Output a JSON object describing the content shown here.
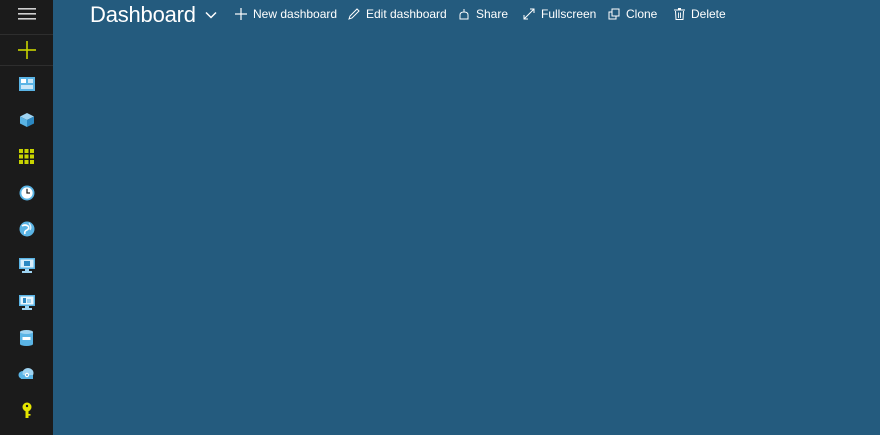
{
  "header": {
    "title": "Dashboard"
  },
  "toolbar": {
    "buttons": [
      {
        "id": "new",
        "label": "New dashboard",
        "icon": "plus-icon"
      },
      {
        "id": "edit",
        "label": "Edit dashboard",
        "icon": "pencil-icon"
      },
      {
        "id": "share",
        "label": "Share",
        "icon": "share-icon"
      },
      {
        "id": "fullscreen",
        "label": "Fullscreen",
        "icon": "expand-icon"
      },
      {
        "id": "clone",
        "label": "Clone",
        "icon": "clone-icon"
      },
      {
        "id": "delete",
        "label": "Delete",
        "icon": "trash-icon"
      }
    ]
  },
  "sidebar": {
    "items": [
      {
        "icon": "dashboard-icon"
      },
      {
        "icon": "resource-cube-icon"
      },
      {
        "icon": "grid-icon"
      },
      {
        "icon": "clock-icon"
      },
      {
        "icon": "globe-icon"
      },
      {
        "icon": "virtual-machine-icon"
      },
      {
        "icon": "monitor-icon"
      },
      {
        "icon": "sql-database-icon"
      },
      {
        "icon": "cloud-service-icon"
      },
      {
        "icon": "key-icon"
      }
    ]
  },
  "colors": {
    "background": "#245b7e",
    "rail": "#1b1b1b",
    "accent_yellow": "#c8d400",
    "icon_blue": "#5ab4e5"
  }
}
